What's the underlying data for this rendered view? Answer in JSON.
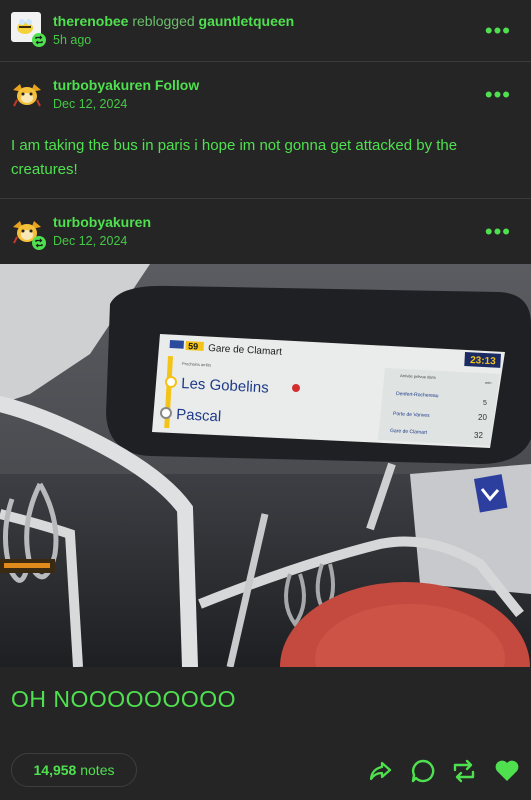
{
  "reblog": {
    "user": "therenobee",
    "action": "reblogged",
    "source": "gauntletqueen",
    "time": "5h ago"
  },
  "post1": {
    "user": "turbobyakuren",
    "follow": "Follow",
    "date": "Dec 12, 2024",
    "text": "I am taking the bus in paris i hope im not gonna get attacked by the creatures!"
  },
  "post2": {
    "user": "turbobyakuren",
    "date": "Dec 12, 2024",
    "caption": "OH NOOOOOOOOO"
  },
  "photo": {
    "line": "59",
    "destination": "Gare de Clamart",
    "time": "23:13",
    "stops": [
      "Les Gobelins",
      "Pascal"
    ],
    "next_label": "Prochains arrêts",
    "arrival_header": "Arrivée prévue dans",
    "arrival_unit": "min",
    "arrivals": [
      {
        "stop": "Denfert-Rochereau",
        "min": "5"
      },
      {
        "stop": "Porte de Vanves",
        "min": "20"
      },
      {
        "stop": "Gare de Clamart",
        "min": "32"
      }
    ]
  },
  "footer": {
    "notes_count": "14,958",
    "notes_label": "notes"
  },
  "colors": {
    "accent": "#4fe04f",
    "background": "#252525"
  },
  "icons": [
    "share-icon",
    "comment-icon",
    "reblog-icon",
    "like-heart-icon",
    "more-dots-icon",
    "reblog-badge-icon"
  ]
}
